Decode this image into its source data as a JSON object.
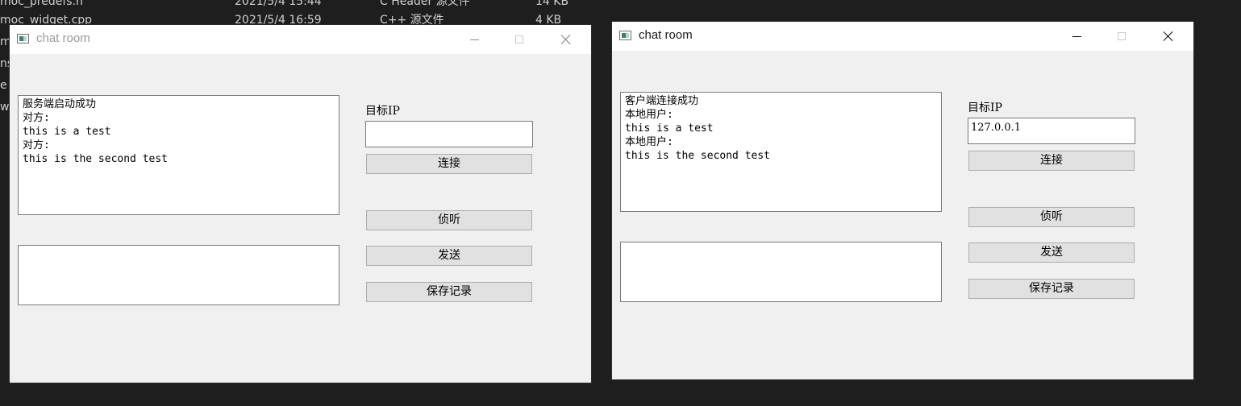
{
  "explorer": {
    "rows": [
      {
        "name": "moc_predefs.h",
        "date": "2021/5/4 15:44",
        "type": "C Header 源文件",
        "size": "14 KB"
      },
      {
        "name": "moc_widget.cpp",
        "date": "2021/5/4 16:59",
        "type": "C++ 源文件",
        "size": "4 KB"
      }
    ],
    "left_stubs": [
      "mo",
      "ns",
      "e",
      "wi"
    ]
  },
  "windows": [
    {
      "title": "chat room",
      "state": "inactive",
      "chat_lines": "服务端启动成功\n对方:\nthis is a test\n对方:\nthis is the second test",
      "message_value": "",
      "ip_label": "目标IP",
      "ip_value": "",
      "buttons": {
        "connect": "连接",
        "listen": "侦听",
        "send": "发送",
        "save": "保存记录"
      }
    },
    {
      "title": "chat room",
      "state": "active",
      "chat_lines": "客户端连接成功\n本地用户:\nthis is a test\n本地用户:\nthis is the second test",
      "message_value": "",
      "ip_label": "目标IP",
      "ip_value": "127.0.0.1",
      "buttons": {
        "connect": "连接",
        "listen": "侦听",
        "send": "发送",
        "save": "保存记录"
      }
    }
  ],
  "colors": {
    "desktop": "#1e1e1e",
    "window_bg": "#f0f0f0",
    "button_bg": "#e1e1e1",
    "icon_accent": "#3c7f73"
  }
}
